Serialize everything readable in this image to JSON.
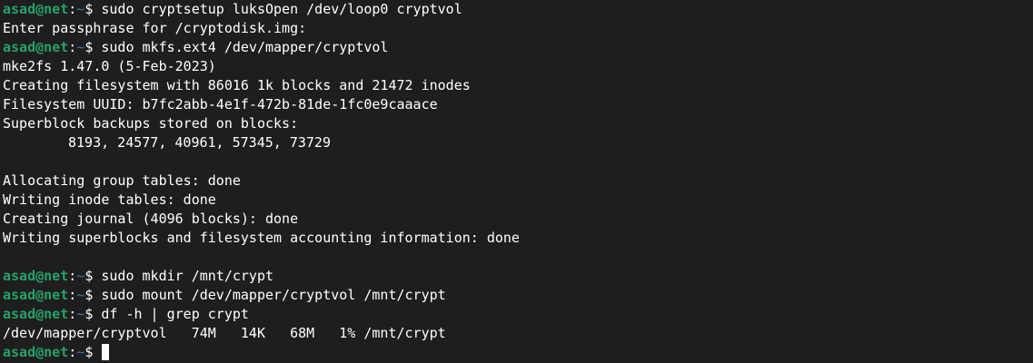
{
  "prompt": {
    "user_host": "asad@net",
    "separator": ":",
    "path": "~",
    "symbol": "$"
  },
  "lines": [
    {
      "type": "command",
      "text": " sudo cryptsetup luksOpen /dev/loop0 cryptvol"
    },
    {
      "type": "output",
      "text": "Enter passphrase for /cryptodisk.img:"
    },
    {
      "type": "command",
      "text": " sudo mkfs.ext4 /dev/mapper/cryptvol"
    },
    {
      "type": "output",
      "text": "mke2fs 1.47.0 (5-Feb-2023)"
    },
    {
      "type": "output",
      "text": "Creating filesystem with 86016 1k blocks and 21472 inodes"
    },
    {
      "type": "output",
      "text": "Filesystem UUID: b7fc2abb-4e1f-472b-81de-1fc0e9caaace"
    },
    {
      "type": "output",
      "text": "Superblock backups stored on blocks:"
    },
    {
      "type": "output-indent",
      "text": "8193, 24577, 40961, 57345, 73729"
    },
    {
      "type": "blank",
      "text": ""
    },
    {
      "type": "output",
      "text": "Allocating group tables: done"
    },
    {
      "type": "output",
      "text": "Writing inode tables: done"
    },
    {
      "type": "output",
      "text": "Creating journal (4096 blocks): done"
    },
    {
      "type": "output",
      "text": "Writing superblocks and filesystem accounting information: done"
    },
    {
      "type": "blank",
      "text": ""
    },
    {
      "type": "command",
      "text": " sudo mkdir /mnt/crypt"
    },
    {
      "type": "command",
      "text": " sudo mount /dev/mapper/cryptvol /mnt/crypt"
    },
    {
      "type": "command",
      "text": " df -h | grep crypt"
    },
    {
      "type": "output",
      "text": "/dev/mapper/cryptvol   74M   14K   68M   1% /mnt/crypt"
    },
    {
      "type": "active",
      "text": " "
    }
  ],
  "colors": {
    "background": "#1e1e1e",
    "prompt_user": "#26a269",
    "prompt_path": "#4a6fa5",
    "text": "#ffffff"
  }
}
